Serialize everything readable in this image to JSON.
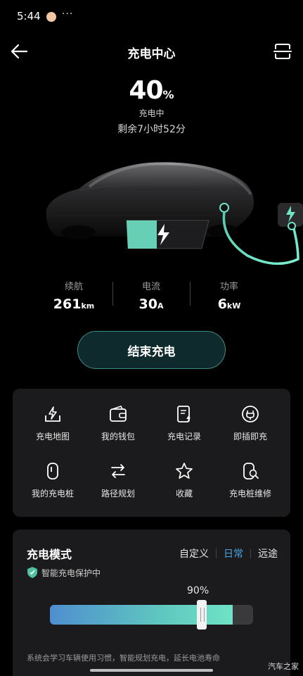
{
  "status_bar": {
    "time": "5:44",
    "dots": "···"
  },
  "header": {
    "title": "充电中心"
  },
  "battery": {
    "percent_value": "40",
    "percent_unit": "%",
    "status": "充电中",
    "remaining": "剩余7小时52分",
    "level_fraction": 0.4
  },
  "stats": [
    {
      "label": "续航",
      "value": "261",
      "unit": "km"
    },
    {
      "label": "电流",
      "value": "30",
      "unit": "A"
    },
    {
      "label": "功率",
      "value": "6",
      "unit": "kW"
    }
  ],
  "end_button": {
    "label": "结束充电"
  },
  "menu": {
    "items": [
      {
        "label": "充电地图",
        "icon": "charging-map-icon"
      },
      {
        "label": "我的钱包",
        "icon": "wallet-icon"
      },
      {
        "label": "充电记录",
        "icon": "charging-record-icon"
      },
      {
        "label": "即插即充",
        "icon": "plug-and-charge-icon"
      },
      {
        "label": "我的充电桩",
        "icon": "charging-pile-icon"
      },
      {
        "label": "路径规划",
        "icon": "route-planning-icon"
      },
      {
        "label": "收藏",
        "icon": "star-icon"
      },
      {
        "label": "充电桩维修",
        "icon": "pile-repair-icon"
      }
    ]
  },
  "charging_mode": {
    "title": "充电模式",
    "tabs": [
      {
        "label": "自定义",
        "active": false
      },
      {
        "label": "日常",
        "active": true
      },
      {
        "label": "远途",
        "active": false
      }
    ],
    "protection_text": "智能充电保护中",
    "limit_label": "90%",
    "limit_fraction": 0.9,
    "description": "系统会学习车辆使用习惯，智能规划充电，延长电池寿命"
  },
  "watermark": "汽车之家",
  "colors": {
    "accent_blue": "#4aa4df",
    "accent_green": "#6fe3c5",
    "card_bg": "#1b1b1d"
  }
}
